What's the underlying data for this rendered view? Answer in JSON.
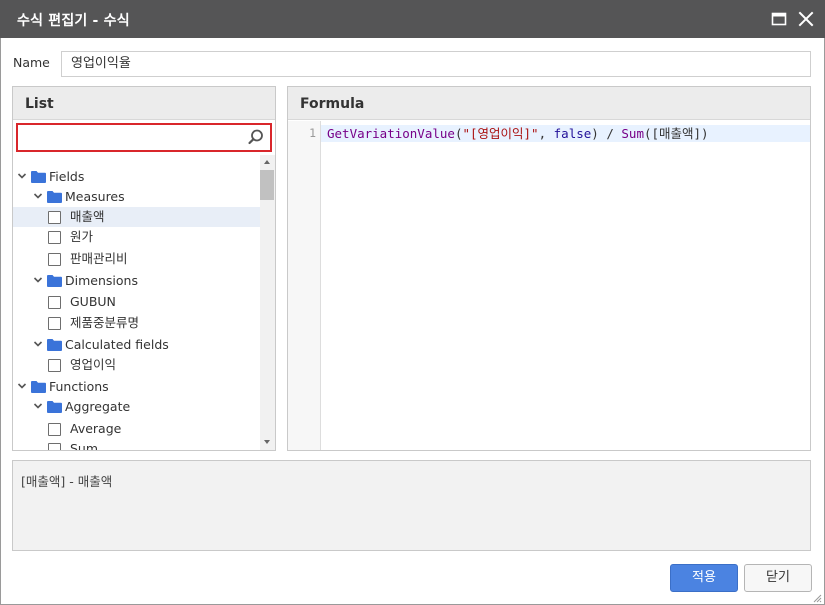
{
  "dialog": {
    "title": "수식 편집기 - 수식",
    "maximize_icon": "window-maximize-icon",
    "close_icon": "close-icon"
  },
  "name_field": {
    "label": "Name",
    "value": "영업이익율"
  },
  "list_panel": {
    "title": "List",
    "search": {
      "value": "",
      "placeholder": ""
    },
    "tree": [
      {
        "level": 0,
        "type": "folder",
        "label": "Fields",
        "expanded": true
      },
      {
        "level": 1,
        "type": "folder",
        "label": "Measures",
        "expanded": true
      },
      {
        "level": 2,
        "type": "item",
        "label": "매출액",
        "checked": false,
        "selected": true
      },
      {
        "level": 2,
        "type": "item",
        "label": "원가",
        "checked": false
      },
      {
        "level": 2,
        "type": "item",
        "label": "판매관리비",
        "checked": false
      },
      {
        "level": 1,
        "type": "folder",
        "label": "Dimensions",
        "expanded": true
      },
      {
        "level": 2,
        "type": "item",
        "label": "GUBUN",
        "checked": false
      },
      {
        "level": 2,
        "type": "item",
        "label": "제품중분류명",
        "checked": false
      },
      {
        "level": 1,
        "type": "folder",
        "label": "Calculated fields",
        "expanded": true
      },
      {
        "level": 2,
        "type": "item",
        "label": "영업이익",
        "checked": false
      },
      {
        "level": 0,
        "type": "folder",
        "label": "Functions",
        "expanded": true
      },
      {
        "level": 1,
        "type": "folder",
        "label": "Aggregate",
        "expanded": true
      },
      {
        "level": 2,
        "type": "item",
        "label": "Average",
        "checked": false
      },
      {
        "level": 2,
        "type": "item",
        "label": "Sum",
        "checked": false
      }
    ]
  },
  "formula_panel": {
    "title": "Formula",
    "line_number": "1",
    "tokens": [
      {
        "text": "GetVariationValue",
        "kind": "fn"
      },
      {
        "text": "(",
        "kind": "p"
      },
      {
        "text": "\"[영업이익]\"",
        "kind": "str"
      },
      {
        "text": ", ",
        "kind": "p"
      },
      {
        "text": "false",
        "kind": "kw"
      },
      {
        "text": ") / ",
        "kind": "p"
      },
      {
        "text": "Sum",
        "kind": "fn"
      },
      {
        "text": "([매출액])",
        "kind": "p"
      }
    ]
  },
  "description": {
    "text": "[매출액] - 매출액"
  },
  "buttons": {
    "apply": "적용",
    "close": "닫기"
  },
  "colors": {
    "titlebar": "#555556",
    "accent": "#4b83e1",
    "search_border": "#d9262b",
    "folder": "#3a73d9"
  }
}
